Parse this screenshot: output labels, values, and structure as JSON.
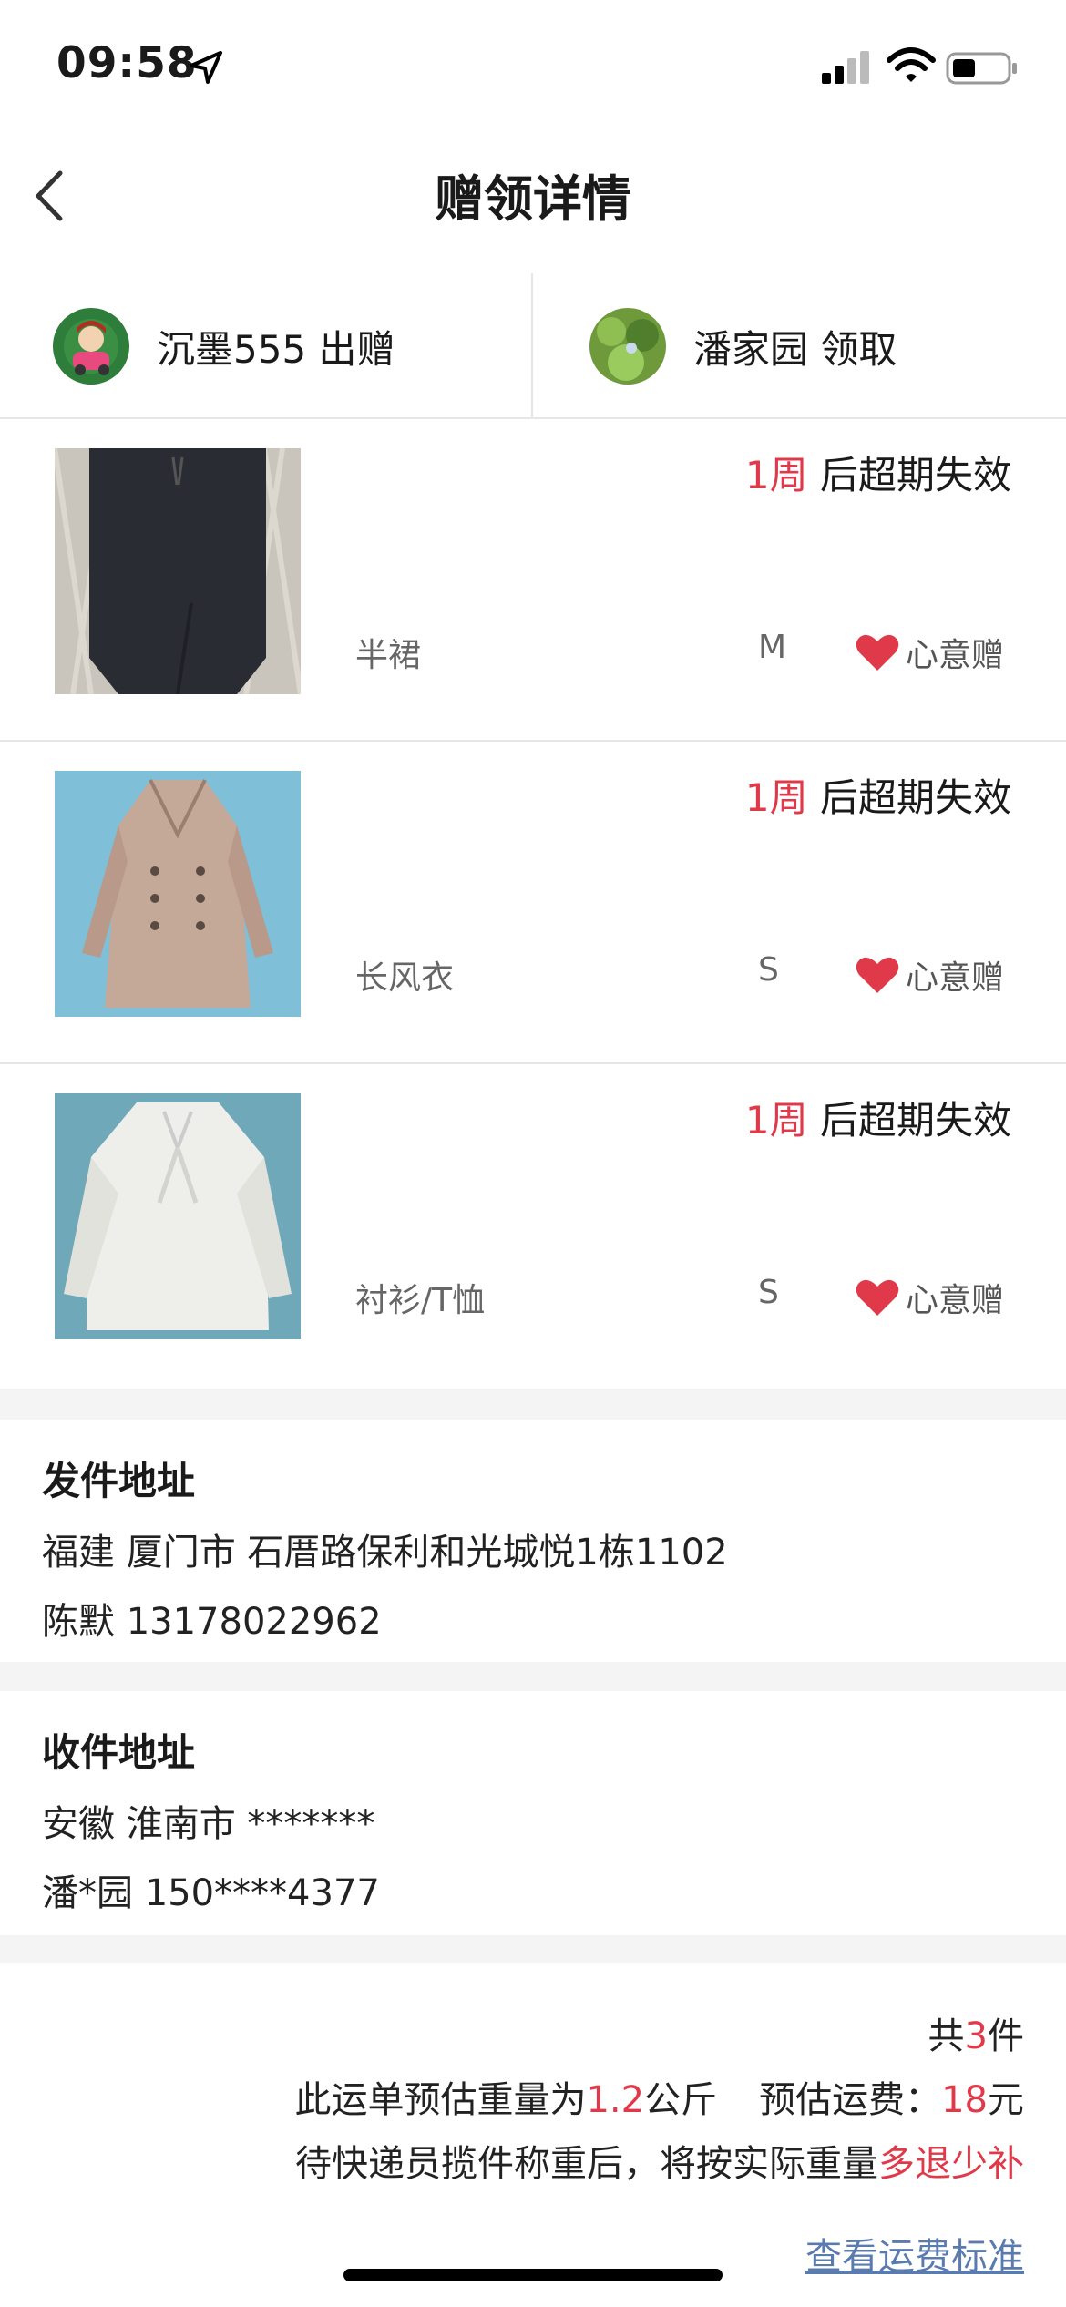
{
  "status_bar": {
    "time": "09:58"
  },
  "nav": {
    "title": "赠领详情"
  },
  "parties": {
    "giver": {
      "name": "沉墨555",
      "action": "出赠",
      "label": "沉墨555 出赠"
    },
    "receiver": {
      "name": "潘家园",
      "action": "领取",
      "label": "潘家园 领取"
    }
  },
  "items": [
    {
      "expire_num": "1周",
      "expire_text": " 后超期失效",
      "name": "半裙",
      "size": "M",
      "tag": "心意赠",
      "thumb_icon": "skirt-photo"
    },
    {
      "expire_num": "1周",
      "expire_text": " 后超期失效",
      "name": "长风衣",
      "size": "S",
      "tag": "心意赠",
      "thumb_icon": "trench-coat-photo"
    },
    {
      "expire_num": "1周",
      "expire_text": " 后超期失效",
      "name": "衬衫/T恤",
      "size": "S",
      "tag": "心意赠",
      "thumb_icon": "shirt-photo"
    }
  ],
  "sender_address": {
    "title": "发件地址",
    "line1": "福建 厦门市 石厝路保利和光城悦1栋1102",
    "line2": "陈默 13178022962"
  },
  "receiver_address": {
    "title": "收件地址",
    "line1": "安徽 淮南市 *******",
    "line2": "潘*园 150****4377"
  },
  "summary": {
    "count_prefix": "共",
    "count": "3",
    "count_suffix": "件",
    "weight_prefix": "此运单预估重量为",
    "weight": "1.2",
    "weight_suffix": "公斤",
    "fee_prefix": "预估运费：",
    "fee": "18",
    "fee_suffix": "元",
    "note_prefix": "待快递员揽件称重后，将按实际重量",
    "note_highlight": "多退少补",
    "fee_link": "查看运费标准"
  },
  "colors": {
    "accent_red": "#e03a4a",
    "link_blue": "#5a7bb0"
  }
}
